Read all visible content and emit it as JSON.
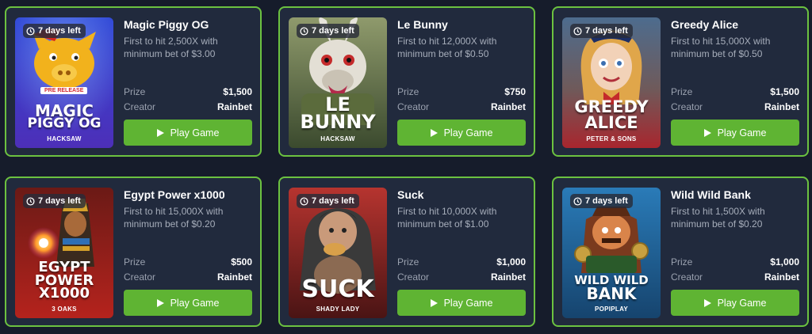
{
  "colors": {
    "background": "#161c2b",
    "card": "#212a3d",
    "card_border": "#6cc240",
    "play_button": "#5fb433"
  },
  "icons": {
    "timer": "clock-icon",
    "play": "play-icon"
  },
  "cards": [
    {
      "badge": "7 days left",
      "title": "Magic Piggy OG",
      "description": "First to hit 2,500X with minimum bet of $3.00",
      "prize_label": "Prize",
      "prize": "$1,500",
      "creator_label": "Creator",
      "creator": "Rainbet",
      "button": "Play Game",
      "thumb": {
        "title_line1": "MAGIC",
        "title_line2": "PIGGY OG",
        "tag": "PRE RELEASE",
        "provider": "HACKSAW",
        "bg_top": "#2f47d6",
        "bg_bottom": "#4d2fb8"
      }
    },
    {
      "badge": "7 days left",
      "title": "Le Bunny",
      "description": "First to hit 12,000X with minimum bet of $0.50",
      "prize_label": "Prize",
      "prize": "$750",
      "creator_label": "Creator",
      "creator": "Rainbet",
      "button": "Play Game",
      "thumb": {
        "title_line1": "LE",
        "title_line2": "BUNNY",
        "provider": "HACKSAW",
        "bg_top": "#8f9a6c",
        "bg_bottom": "#3b4a2e"
      }
    },
    {
      "badge": "7 days left",
      "title": "Greedy Alice",
      "description": "First to hit 15,000X with minimum bet of $0.50",
      "prize_label": "Prize",
      "prize": "$1,500",
      "creator_label": "Creator",
      "creator": "Rainbet",
      "button": "Play Game",
      "thumb": {
        "title_line1": "GREEDY",
        "title_line2": "ALICE",
        "provider": "PETER & SONS",
        "bg_top": "#4d6c8e",
        "bg_bottom": "#a8262e"
      }
    },
    {
      "badge": "7 days left",
      "title": "Egypt Power x1000",
      "description": "First to hit 15,000X with minimum bet of $0.20",
      "prize_label": "Prize",
      "prize": "$500",
      "creator_label": "Creator",
      "creator": "Rainbet",
      "button": "Play Game",
      "thumb": {
        "title_line1": "EGYPT",
        "title_line2": "POWER",
        "title_line3": "X1000",
        "provider": "3 OAKS",
        "bg_top": "#6b1a16",
        "bg_bottom": "#b5231d"
      }
    },
    {
      "badge": "7 days left",
      "title": "Suck",
      "description": "First to hit 10,000X with minimum bet of $1.00",
      "prize_label": "Prize",
      "prize": "$1,000",
      "creator_label": "Creator",
      "creator": "Rainbet",
      "button": "Play Game",
      "thumb": {
        "title_line1": "SUCK",
        "provider": "SHADY LADY",
        "bg_top": "#b6342f",
        "bg_bottom": "#4a1414"
      }
    },
    {
      "badge": "7 days left",
      "title": "Wild Wild Bank",
      "description": "First to hit 1,500X with minimum bet of $0.20",
      "prize_label": "Prize",
      "prize": "$1,000",
      "creator_label": "Creator",
      "creator": "Rainbet",
      "button": "Play Game",
      "thumb": {
        "title_line1": "WILD WILD",
        "title_line2": "BANK",
        "provider": "POPIPLAY",
        "bg_top": "#2a7bb8",
        "bg_bottom": "#16446e"
      }
    }
  ]
}
